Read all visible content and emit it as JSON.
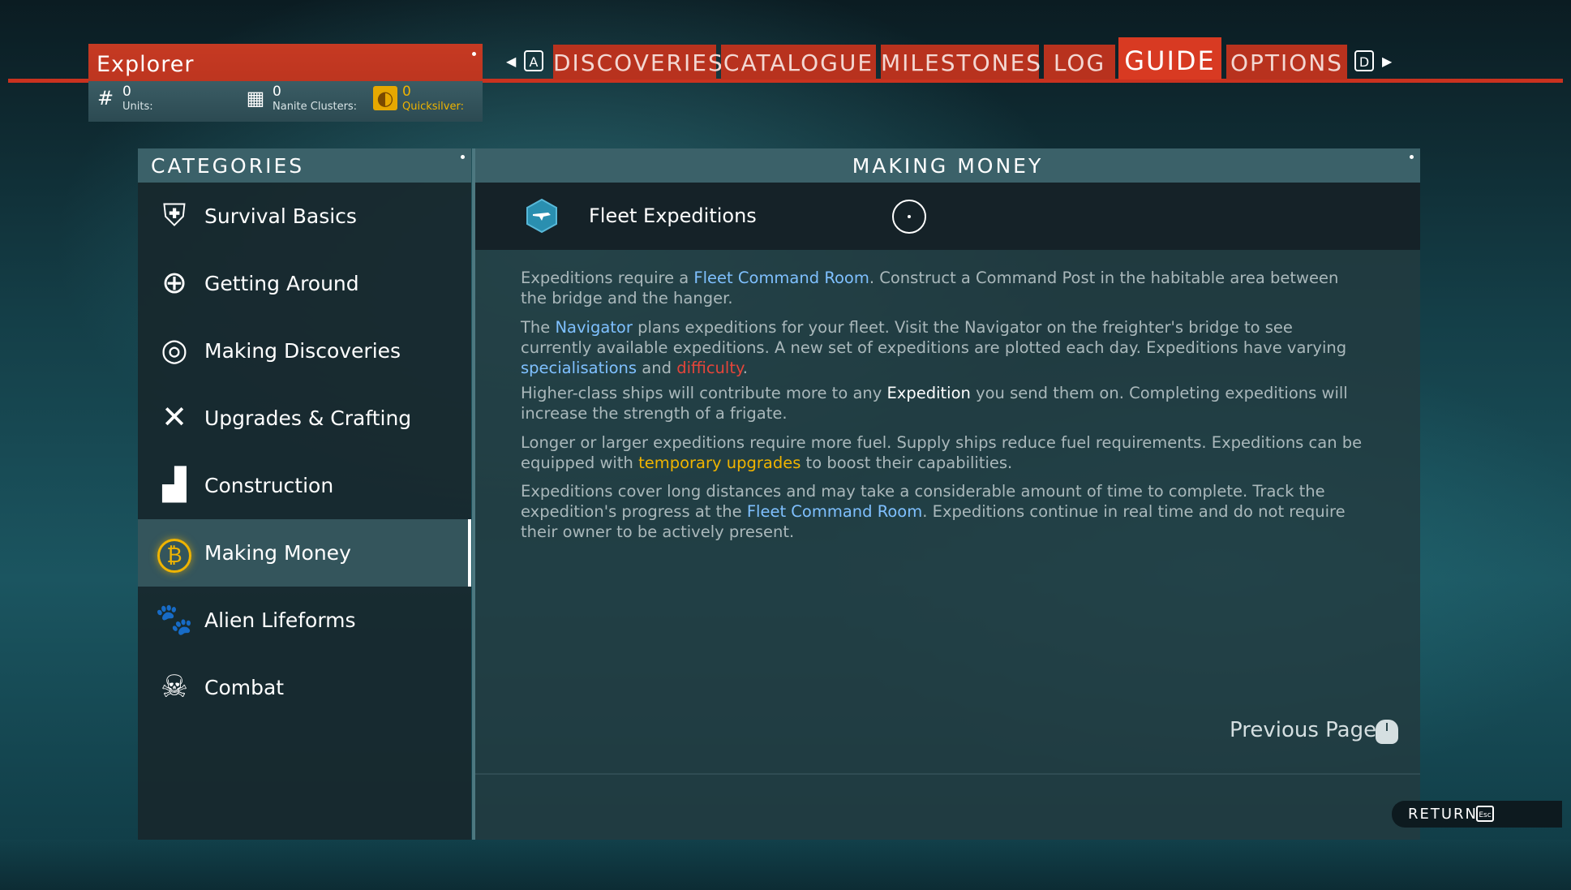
{
  "explorer": {
    "title": "Explorer",
    "currencies": [
      {
        "icon": "units-icon",
        "value": "0",
        "label": "Units:"
      },
      {
        "icon": "nanite-icon",
        "value": "0",
        "label": "Nanite Clusters:"
      },
      {
        "icon": "quicksilver-icon",
        "value": "0",
        "label": "Quicksilver:"
      }
    ]
  },
  "tabs": {
    "prev_key": "A",
    "next_key": "D",
    "items": [
      "DISCOVERIES",
      "CATALOGUE",
      "MILESTONES",
      "LOG",
      "GUIDE",
      "OPTIONS"
    ],
    "active": "GUIDE"
  },
  "categories": {
    "title": "CATEGORIES",
    "items": [
      {
        "label": "Survival Basics",
        "icon": "survival-icon"
      },
      {
        "label": "Getting Around",
        "icon": "compass-icon"
      },
      {
        "label": "Making Discoveries",
        "icon": "spiral-icon"
      },
      {
        "label": "Upgrades & Crafting",
        "icon": "tools-icon"
      },
      {
        "label": "Construction",
        "icon": "construction-icon"
      },
      {
        "label": "Making Money",
        "icon": "coin-icon"
      },
      {
        "label": "Alien Lifeforms",
        "icon": "creature-icon"
      },
      {
        "label": "Combat",
        "icon": "skull-icon"
      }
    ],
    "selected": "Making Money"
  },
  "main": {
    "title": "MAKING MONEY",
    "entry": {
      "title": "Fleet Expeditions",
      "icon": "frigate-icon"
    },
    "paragraphs": {
      "p1": {
        "a": "Expeditions require a ",
        "b": "Fleet Command Room",
        "c": ". Construct a Command Post in the habitable area between the bridge and the hanger."
      },
      "p2": {
        "a": "The ",
        "b": "Navigator",
        "c": " plans expeditions for your fleet. Visit the Navigator on the freighter's bridge to see currently available expeditions. A new set of expeditions are plotted each day. Expeditions have varying ",
        "d": "specialisations",
        "e": " and ",
        "f": "difficulty",
        "g": "."
      },
      "p3": {
        "a": "Higher-class ships will contribute more to any ",
        "b": "Expedition",
        "c": " you send them on. Completing expeditions will increase the strength of a frigate."
      },
      "p4": {
        "a": "Longer or larger expeditions require more fuel. Supply ships reduce fuel requirements. Expeditions can be equipped with ",
        "b": "temporary upgrades",
        "c": " to boost their capabilities."
      },
      "p5": {
        "a": "Expeditions cover long distances and may take a considerable amount of time to complete. Track the expedition's progress at the ",
        "b": "Fleet Command Room",
        "c": ". Expeditions continue in real time and do not require their owner to be actively present."
      }
    },
    "previous_page": "Previous Page"
  },
  "footer": {
    "return_label": "RETURN",
    "return_key": "Esc"
  },
  "colors": {
    "accent_red": "#d83a22",
    "highlight_blue": "#7fc0ff",
    "highlight_red": "#e5453a",
    "highlight_gold": "#f0b400"
  }
}
